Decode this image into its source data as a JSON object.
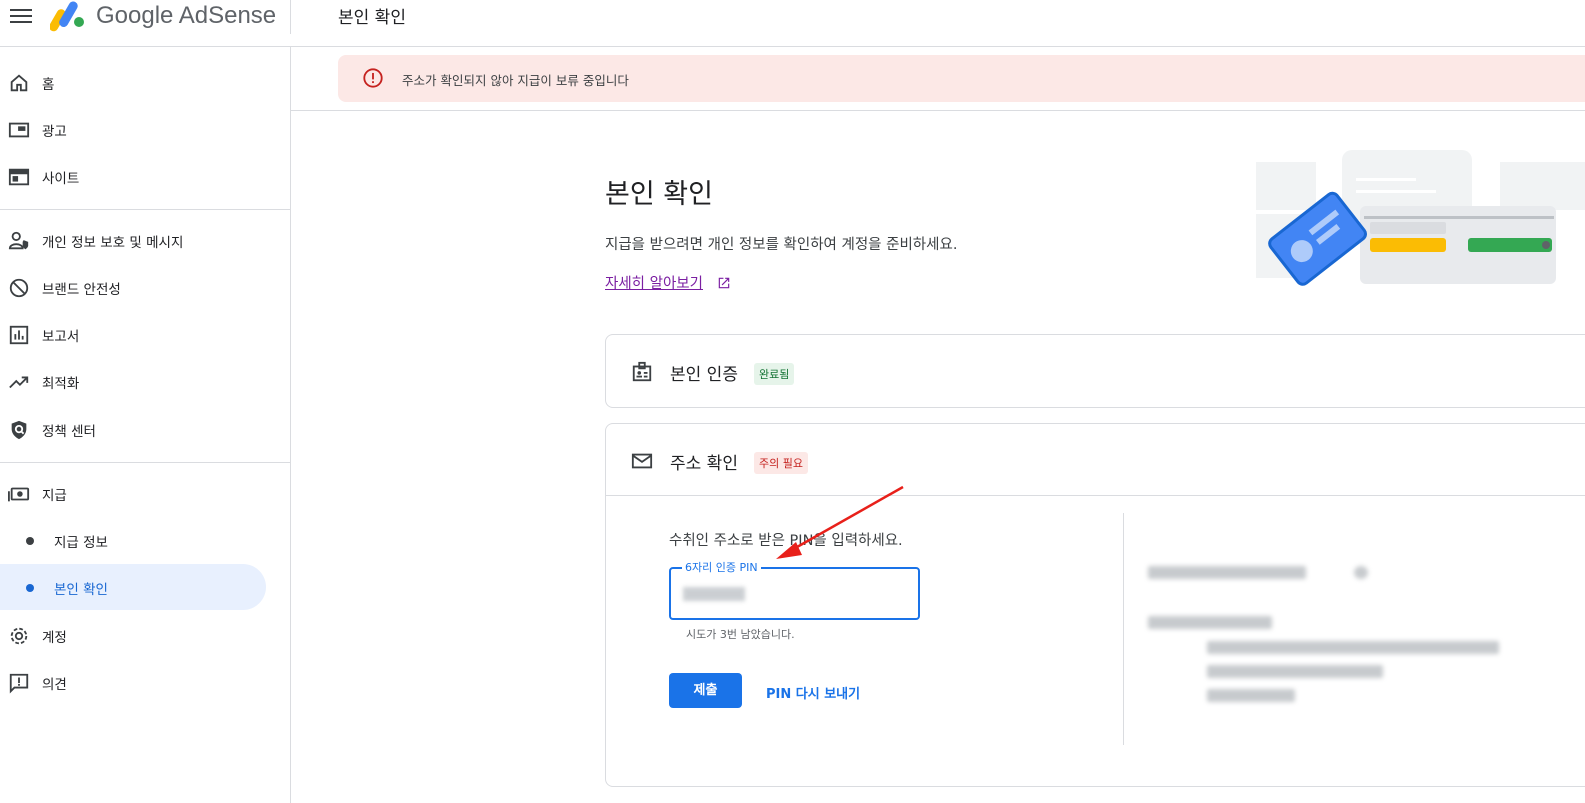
{
  "header": {
    "brand": "Google AdSense",
    "page_title": "본인 확인",
    "menu_icon": "hamburger-menu-icon",
    "logo_colors": [
      "#fbbc04",
      "#4285f4",
      "#34a853"
    ]
  },
  "sidebar": {
    "items": [
      {
        "label": "홈",
        "icon": "home-icon"
      },
      {
        "label": "광고",
        "icon": "ads-icon"
      },
      {
        "label": "사이트",
        "icon": "sites-icon"
      },
      {
        "label": "개인 정보 보호 및 메시지",
        "icon": "privacy-icon"
      },
      {
        "label": "브랜드 안전성",
        "icon": "block-icon"
      },
      {
        "label": "보고서",
        "icon": "reports-icon"
      },
      {
        "label": "최적화",
        "icon": "trending-icon"
      },
      {
        "label": "정책 센터",
        "icon": "policy-shield-icon"
      },
      {
        "label": "지급",
        "icon": "payments-icon"
      },
      {
        "label": "지급 정보",
        "sub": true
      },
      {
        "label": "본인 확인",
        "sub": true,
        "active": true
      },
      {
        "label": "계정",
        "icon": "gear-icon"
      },
      {
        "label": "의견",
        "icon": "feedback-icon"
      }
    ],
    "active_color": "#1967d2"
  },
  "alert": {
    "text": "주소가 확인되지 않아 지급이 보류 중입니다",
    "icon": "error-icon",
    "color": "#c5221f"
  },
  "main": {
    "title": "본인 확인",
    "subtitle": "지급을 받으려면 개인 정보를 확인하여 계정을 준비하세요.",
    "learn_more": "자세히 알아보기",
    "cards": [
      {
        "title": "본인 인증",
        "status": "완료됨",
        "icon": "id-badge-icon"
      },
      {
        "title": "주소 확인",
        "status": "주의 필요",
        "icon": "mail-icon"
      }
    ],
    "address_section": {
      "instruction": "수취인 주소로 받은 PIN을 입력하세요.",
      "pin_label": "6자리 인증 PIN",
      "helper_text": "시도가 3번 남았습니다.",
      "submit_label": "제출",
      "resend_label": "PIN 다시 보내기"
    }
  },
  "colors": {
    "accent": "#1a73e8",
    "alert_bg": "#fce8e6"
  }
}
